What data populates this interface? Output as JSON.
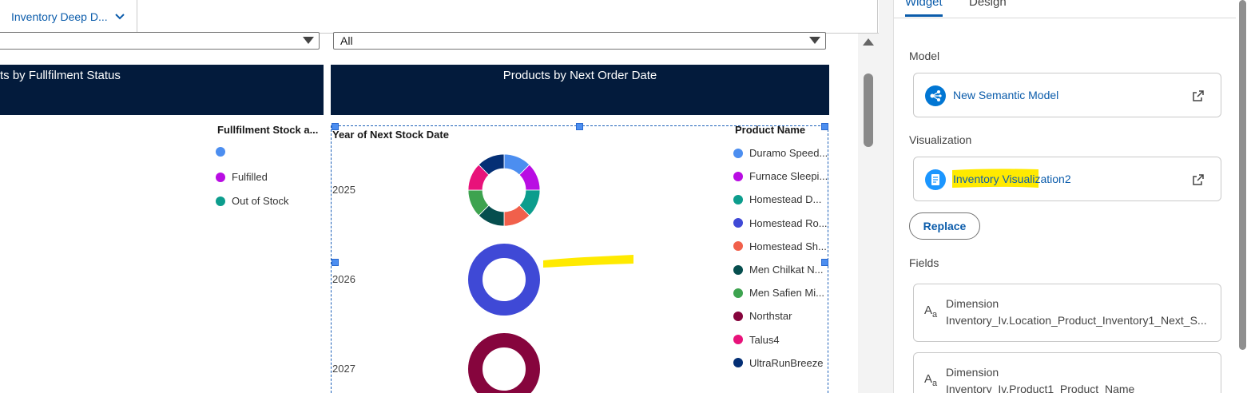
{
  "tab": {
    "label": "Inventory Deep D...",
    "chevron_icon": "chevron-down-icon"
  },
  "filters": {
    "left_value": "",
    "right_value": "All"
  },
  "left_chart": {
    "header_title": "ts by Fullfilment Status",
    "legend_title": "Fullfilment Stock a...",
    "legend": [
      {
        "label": "",
        "color": "#4c8ef0"
      },
      {
        "label": "Fulfilled",
        "color": "#b90de3"
      },
      {
        "label": "Out of Stock",
        "color": "#0c9d8d"
      }
    ]
  },
  "right_chart": {
    "header_title": "Products by Next Order Date",
    "legend_title": "Product Name",
    "legend": [
      {
        "label": "Duramo Speed...",
        "color": "#4c8ef0"
      },
      {
        "label": "Furnace Sleepi...",
        "color": "#b90de3"
      },
      {
        "label": "Homestead D...",
        "color": "#0c9d8d"
      },
      {
        "label": "Homestead Ro...",
        "color": "#3f49d6"
      },
      {
        "label": "Homestead Sh...",
        "color": "#f1604b"
      },
      {
        "label": "Men Chilkat N...",
        "color": "#064e4e"
      },
      {
        "label": "Men Safien Mi...",
        "color": "#3da34f"
      },
      {
        "label": "Northstar",
        "color": "#86053d"
      },
      {
        "label": "Talus4",
        "color": "#e8127a"
      },
      {
        "label": "UltraRunBreeze",
        "color": "#042f75"
      }
    ]
  },
  "chart_data": {
    "type": "pie",
    "title": "Products by Next Order Date",
    "xlabel": "Year of Next Stock Date",
    "categories": [
      "2025",
      "2026",
      "2027"
    ],
    "series": [
      {
        "name": "Duramo Speed...",
        "values": [
          1,
          0,
          0
        ]
      },
      {
        "name": "Furnace Sleepi...",
        "values": [
          1,
          0,
          0
        ]
      },
      {
        "name": "Homestead D...",
        "values": [
          1,
          0,
          0
        ]
      },
      {
        "name": "Homestead Ro...",
        "values": [
          0,
          1,
          0
        ]
      },
      {
        "name": "Homestead Sh...",
        "values": [
          1,
          0,
          0
        ]
      },
      {
        "name": "Men Chilkat N...",
        "values": [
          1,
          0,
          0
        ]
      },
      {
        "name": "Men Safien Mi...",
        "values": [
          1,
          0,
          0
        ]
      },
      {
        "name": "Northstar",
        "values": [
          0,
          0,
          1
        ]
      },
      {
        "name": "Talus4",
        "values": [
          1,
          0,
          0
        ]
      },
      {
        "name": "UltraRunBreeze",
        "values": [
          1,
          0,
          0
        ]
      }
    ],
    "legend_position": "right"
  },
  "panel": {
    "tabs": [
      {
        "label": "Widget",
        "active": true
      },
      {
        "label": "Design",
        "active": false
      }
    ],
    "model_label": "Model",
    "model_name": "New Semantic Model",
    "model_icon": "semantic-model-icon",
    "visualization_label": "Visualization",
    "visualization_name": "Inventory Visualization2",
    "visualization_icon": "document-icon",
    "replace_label": "Replace",
    "fields_label": "Fields",
    "fields": [
      {
        "kind": "Dimension",
        "value": "Inventory_Iv.Location_Product_Inventory1_Next_S...",
        "icon": "text-type-icon"
      },
      {
        "kind": "Dimension",
        "value": "Inventory_Iv.Product1_Product_Name",
        "icon": "text-type-icon"
      }
    ]
  },
  "colors": {
    "header_bg": "#031b3c",
    "accent": "#0b5cab",
    "highlight": "#ffea00"
  }
}
